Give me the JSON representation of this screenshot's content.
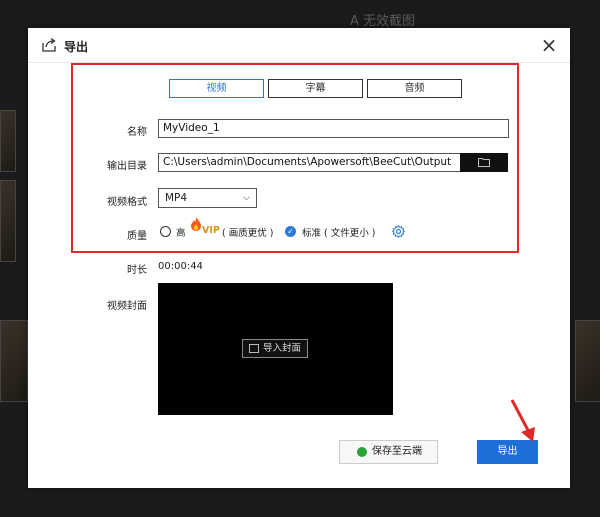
{
  "background": {
    "watermark": "A 无效截图"
  },
  "dialog": {
    "title": "导出",
    "close_glyph": "×",
    "tabs": [
      {
        "label": "视频",
        "active": true
      },
      {
        "label": "字幕",
        "active": false
      },
      {
        "label": "音频",
        "active": false
      }
    ],
    "name": {
      "label": "名称",
      "value": "MyVideo_1"
    },
    "output_dir": {
      "label": "输出目录",
      "value": "C:\\Users\\admin\\Documents\\Apowersoft\\BeeCut\\Output"
    },
    "format": {
      "label": "视频格式",
      "value": "MP4"
    },
    "quality": {
      "label": "质量",
      "high_label": "高",
      "vip_label": "VIP",
      "high_note": "( 画质更优 )",
      "standard_label": "标准 ( 文件更小 )",
      "selected": "standard"
    },
    "duration": {
      "label": "时长",
      "value": "00:00:44"
    },
    "cover": {
      "label": "视频封面",
      "import_label": "导入封面"
    },
    "save_cloud_label": "保存至云端",
    "export_label": "导出",
    "colors": {
      "accent": "#1f6fd9",
      "highlight_frame": "#e02a2a",
      "cloud_dot": "#27a13a"
    }
  }
}
